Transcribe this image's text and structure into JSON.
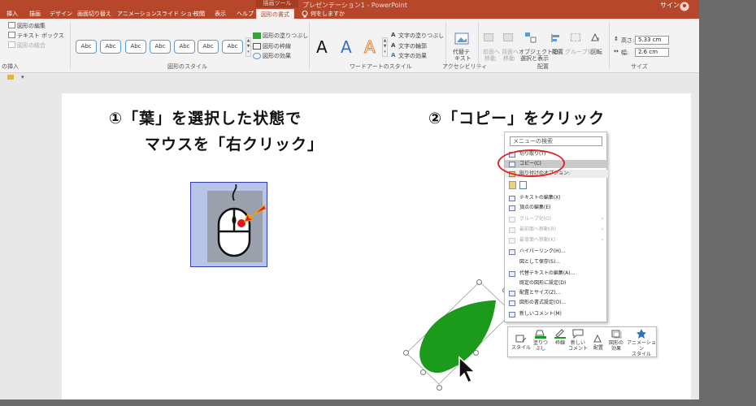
{
  "window": {
    "title": "プレゼンテーション1 - PowerPoint",
    "context_group": "描画ツール",
    "user": "サイン"
  },
  "tabs": [
    "挿入",
    "描画",
    "デザイン",
    "画面切り替え",
    "アニメーション",
    "スライド ショー",
    "校閲",
    "表示",
    "ヘルプ",
    "図形の書式"
  ],
  "tell_me": "何をしますか",
  "ribbon": {
    "insert_shapes": {
      "edit_shape": "図形の編集",
      "text_box": "テキスト ボックス",
      "merge_shapes": "図形の結合",
      "label": "の挿入"
    },
    "shape_styles": {
      "samples": [
        "Abc",
        "Abc",
        "Abc",
        "Abc",
        "Abc",
        "Abc",
        "Abc"
      ],
      "fill": "図形の塗りつぶし",
      "outline": "図形の枠線",
      "effects": "図形の効果",
      "label": "図形のスタイル"
    },
    "wordart": {
      "samples": [
        "A",
        "A",
        "A"
      ],
      "text_fill": "文字の塗りつぶし",
      "text_outline": "文字の輪郭",
      "text_effects": "文字の効果",
      "label": "ワードアートのスタイル"
    },
    "accessibility": {
      "alt_text_1": "代替テ",
      "alt_text_2": "キスト",
      "label": "アクセシビリティ"
    },
    "arrange": {
      "bring_forward": "前面へ",
      "bring_forward_2": "移動",
      "send_backward": "背面へ",
      "send_backward_2": "移動",
      "selection_1": "オブジェクトの",
      "selection_2": "選択と表示",
      "align": "配置",
      "group": "グループ化",
      "rotate": "回転",
      "label": "配置"
    },
    "size": {
      "height_label": "高さ:",
      "height_value": "5.33 cm",
      "width_label": "幅:",
      "width_value": "2.6 cm",
      "label": "サイズ"
    }
  },
  "slide": {
    "step1_line1": "①「葉」を選択した状態で",
    "step1_line2": "マウスを「右クリック」",
    "step2": "②「コピー」をクリック"
  },
  "context_menu": {
    "search_placeholder": "メニューの検索",
    "items": [
      {
        "label": "切り取り(T)",
        "state": "normal"
      },
      {
        "label": "コピー(C)",
        "state": "highlight"
      },
      {
        "label": "貼り付けのオプション:",
        "state": "subheader"
      },
      {
        "label": "",
        "state": "paste-icons"
      },
      {
        "label": "テキストの編集(X)",
        "state": "normal"
      },
      {
        "label": "頂点の編集(E)",
        "state": "normal"
      },
      {
        "label": "グループ化(G)",
        "state": "disabled"
      },
      {
        "label": "最前面へ移動(R)",
        "state": "disabled"
      },
      {
        "label": "最背面へ移動(K)",
        "state": "disabled"
      },
      {
        "label": "ハイパーリンク(H)...",
        "state": "normal"
      },
      {
        "label": "図として保存(S)...",
        "state": "normal"
      },
      {
        "label": "代替テキストの編集(A)...",
        "state": "normal"
      },
      {
        "label": "既定の図形に設定(D)",
        "state": "normal"
      },
      {
        "label": "配置とサイズ(Z)...",
        "state": "normal"
      },
      {
        "label": "図形の書式設定(O)...",
        "state": "normal"
      },
      {
        "label": "新しいコメント(M)",
        "state": "normal"
      }
    ]
  },
  "mini_toolbar": {
    "style": "スタイル",
    "fill_1": "塗りつ",
    "fill_2": "ぶし",
    "outline": "枠線",
    "comment_1": "新しい",
    "comment_2": "コメント",
    "arrange": "配置",
    "effects_1": "図形の",
    "effects_2": "効果",
    "animation_1": "アニメーション",
    "animation_2": "スタイル"
  },
  "colors": {
    "accent": "#b7472a",
    "leaf": "#1c9a1c",
    "highlight_circle": "#e0262d"
  }
}
